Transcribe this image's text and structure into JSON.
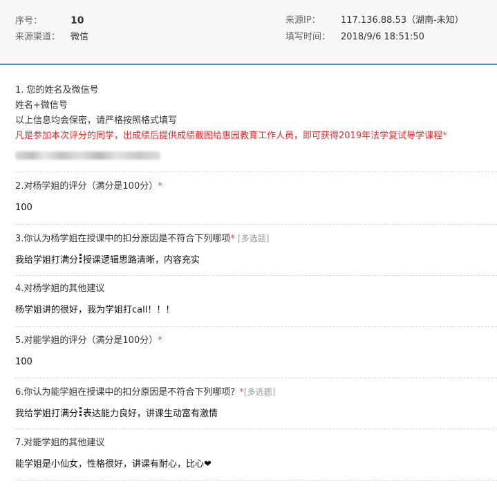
{
  "header": {
    "serial_label": "序号：",
    "serial_value": "10",
    "channel_label": "来源渠道：",
    "channel_value": "微信",
    "ip_label": "来源IP：",
    "ip_value": "117.136.88.53（湖南-未知）",
    "time_label": "填写时间：",
    "time_value": "2018/9/6 18:51:50"
  },
  "questions": [
    {
      "title": "1. 您的姓名及微信号",
      "note1": "姓名+微信号",
      "note2": "以上信息均会保密，请严格按照格式填写",
      "note3": "凡是参加本次评分的同学，出成绩后提供成绩截图给惠园教育工作人员，即可获得2019年法学复试导学课程",
      "required": "*"
    },
    {
      "title": "2.对杨学姐的评分（满分是100分）",
      "required": "*",
      "answer": "100"
    },
    {
      "title": "3.你认为杨学姐在授课中的扣分原因是不符合下列哪项",
      "required": "*",
      "tag": "[多选题]",
      "answer_a": "我给学姐打满分",
      "answer_b": "授课逻辑思路清晰，内容充实"
    },
    {
      "title": "4.对杨学姐的其他建议",
      "answer": "杨学姐讲的很好，我为学姐打call！！！"
    },
    {
      "title": "5.对能学姐的评分（满分是100分）",
      "required": "*",
      "answer": "100"
    },
    {
      "title": "6.你认为能学姐在授课中的扣分原因是不符合下列哪项？",
      "required": "*",
      "tag": "[多选题]",
      "answer_a": "我给学姐打满分",
      "answer_b": "表达能力良好，讲课生动富有激情"
    },
    {
      "title": "7.对能学姐的其他建议",
      "answer": "能学姐是小仙女，性格很好，讲课有耐心，比心❤"
    }
  ]
}
